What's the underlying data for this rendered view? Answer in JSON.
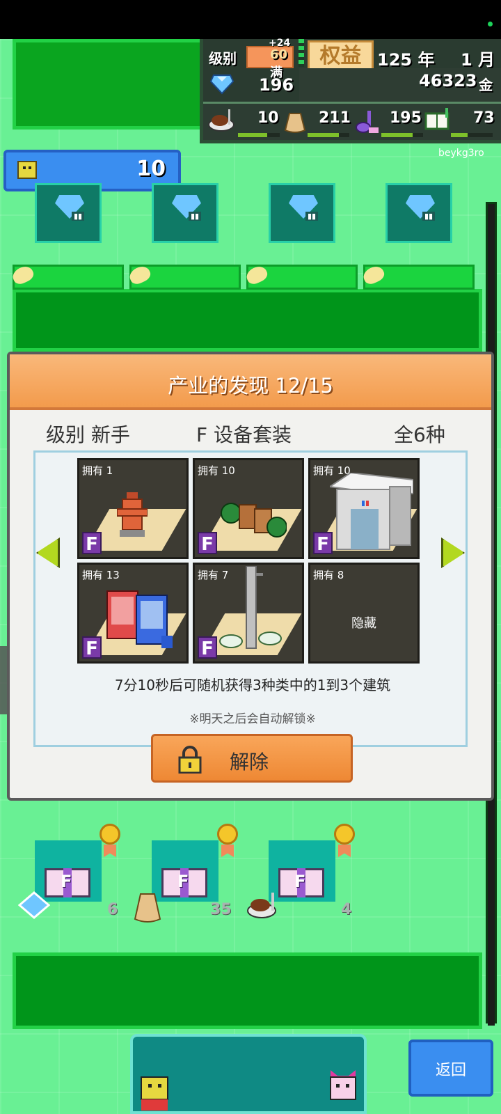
{
  "hud": {
    "level_label": "级别",
    "level_plus": "+24",
    "level_value": "60",
    "level_max": "满",
    "equity_label": "权益",
    "year": "125 年",
    "month": "1 月",
    "gems": "196",
    "gold": "46323",
    "gold_unit": "金",
    "resources": [
      {
        "icon": "food-icon",
        "value": "10"
      },
      {
        "icon": "sack-icon",
        "value": "211"
      },
      {
        "icon": "music-note-icon",
        "value": "195"
      },
      {
        "icon": "book-icon",
        "value": "73"
      }
    ]
  },
  "user_id": "beykg3ro",
  "counter": {
    "value": "10"
  },
  "dialog": {
    "title": "产业的发现 12/15",
    "level_text": "级别 新手",
    "category_text": "F  设备套装",
    "total_text": "全6种",
    "cards": [
      {
        "owned": "拥有 1",
        "item": "fire-hydrant",
        "badge": "F"
      },
      {
        "owned": "拥有 10",
        "item": "bushes-and-crates",
        "badge": "F"
      },
      {
        "owned": "拥有 10",
        "item": "elevator-building",
        "badge": "F"
      },
      {
        "owned": "拥有 13",
        "item": "vending-machines",
        "badge": "F"
      },
      {
        "owned": "拥有 7",
        "item": "street-lamp",
        "badge": "F"
      },
      {
        "owned": "拥有 8",
        "item": "hidden",
        "badge": "",
        "hidden_label": "隐藏"
      }
    ],
    "timer_text": "7分10秒后可随机获得3种类中的1到3个建筑",
    "note_text": "※明天之后会自动解锁※",
    "unlock_label": "解除"
  },
  "rewards": [
    {
      "icon": "gem-icon",
      "count": "6"
    },
    {
      "icon": "sack-icon",
      "count": "35"
    },
    {
      "icon": "food-icon",
      "count": "4"
    }
  ],
  "back_label": "返回",
  "colors": {
    "background": "#69f094",
    "dialog_header": "#f39b4c",
    "accent_blue": "#3a8ef0"
  }
}
